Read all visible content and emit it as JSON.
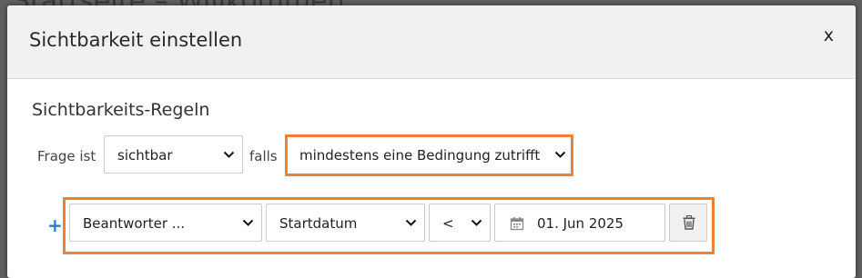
{
  "background": {
    "title": "Startseite – Willkommen"
  },
  "modal": {
    "title": "Sichtbarkeit einstellen",
    "close_label": "x"
  },
  "rules": {
    "heading": "Sichtbarkeits-Regeln",
    "prefix_label": "Frage ist",
    "visibility_value": "sichtbar",
    "condition_label": "falls",
    "match_value": "mindestens eine Bedingung zutrifft"
  },
  "condition": {
    "add_label": "+",
    "subject_value": "Beantworter ...",
    "field_value": "Startdatum",
    "operator_value": "<",
    "date_value": "01. Jun 2025"
  },
  "colors": {
    "highlight": "#ee8231",
    "accent": "#1f7ed8",
    "header_bg": "#f1f1f2"
  }
}
